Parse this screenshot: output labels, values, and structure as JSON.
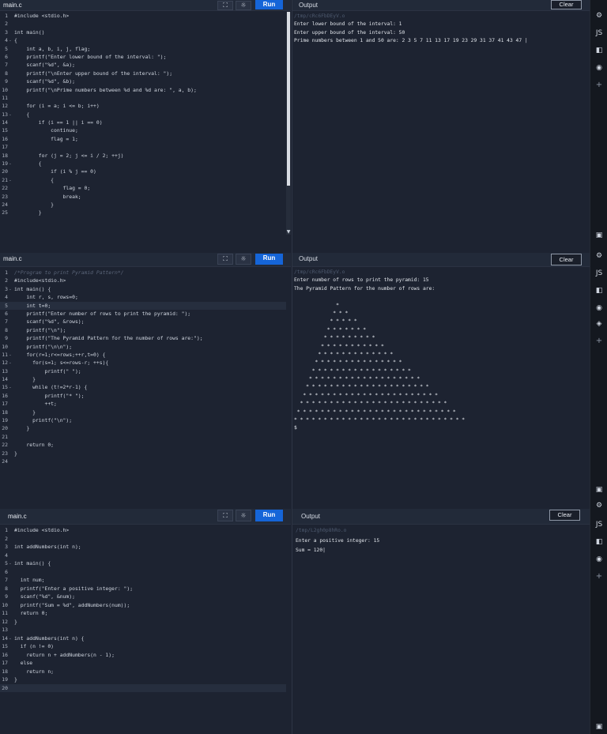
{
  "panels": [
    {
      "file": "main.c",
      "run_label": "Run",
      "output_title": "Output",
      "clear_label": "Clear",
      "code": [
        {
          "n": "1",
          "f": "",
          "t": "#include <stdio.h>"
        },
        {
          "n": "2",
          "f": "",
          "t": ""
        },
        {
          "n": "3",
          "f": "",
          "t": "int main()"
        },
        {
          "n": "4",
          "f": "-",
          "t": "{"
        },
        {
          "n": "5",
          "f": "",
          "t": "    int a, b, i, j, flag;"
        },
        {
          "n": "6",
          "f": "",
          "t": "    printf(\"Enter lower bound of the interval: \");"
        },
        {
          "n": "7",
          "f": "",
          "t": "    scanf(\"%d\", &a);"
        },
        {
          "n": "8",
          "f": "",
          "t": "    printf(\"\\nEnter upper bound of the interval: \");"
        },
        {
          "n": "9",
          "f": "",
          "t": "    scanf(\"%d\", &b);"
        },
        {
          "n": "10",
          "f": "",
          "t": "    printf(\"\\nPrime numbers between %d and %d are: \", a, b);"
        },
        {
          "n": "11",
          "f": "",
          "t": ""
        },
        {
          "n": "12",
          "f": "",
          "t": "    for (i = a; i <= b; i++)"
        },
        {
          "n": "13",
          "f": "-",
          "t": "    {"
        },
        {
          "n": "14",
          "f": "",
          "t": "        if (i == 1 || i == 0)"
        },
        {
          "n": "15",
          "f": "",
          "t": "            continue;"
        },
        {
          "n": "16",
          "f": "",
          "t": "            flag = 1;"
        },
        {
          "n": "17",
          "f": "",
          "t": ""
        },
        {
          "n": "18",
          "f": "",
          "t": "        for (j = 2; j <= i / 2; ++j)"
        },
        {
          "n": "19",
          "f": "-",
          "t": "        {"
        },
        {
          "n": "20",
          "f": "",
          "t": "            if (i % j == 0)"
        },
        {
          "n": "21",
          "f": "-",
          "t": "            {"
        },
        {
          "n": "22",
          "f": "",
          "t": "                flag = 0;"
        },
        {
          "n": "23",
          "f": "",
          "t": "                break;"
        },
        {
          "n": "24",
          "f": "",
          "t": "            }"
        },
        {
          "n": "25",
          "f": "",
          "t": "        }"
        }
      ],
      "output": [
        {
          "t": "/tmp/cRc6FbDEyV.o",
          "path": true
        },
        {
          "t": "Enter lower bound of the interval: 1"
        },
        {
          "t": "Enter upper bound of the interval: 50"
        },
        {
          "t": "Prime numbers between 1 and 50 are: 2 3 5 7 11 13 17 19 23 29 31 37 41 43 47 |"
        }
      ]
    },
    {
      "file": "main.c",
      "run_label": "Run",
      "output_title": "Output",
      "clear_label": "Clear",
      "code": [
        {
          "n": "1",
          "f": "",
          "t": "/*Program to print Pyramid Pattern*/",
          "cmt": true
        },
        {
          "n": "2",
          "f": "",
          "t": "#include<stdio.h>"
        },
        {
          "n": "3",
          "f": "-",
          "t": "int main() {"
        },
        {
          "n": "4",
          "f": "",
          "t": "    int r, s, rows=0;"
        },
        {
          "n": "5",
          "f": "",
          "t": "    int t=0;",
          "active": true
        },
        {
          "n": "6",
          "f": "",
          "t": "    printf(\"Enter number of rows to print the pyramid: \");"
        },
        {
          "n": "7",
          "f": "",
          "t": "    scanf(\"%d\", &rows);"
        },
        {
          "n": "8",
          "f": "",
          "t": "    printf(\"\\n\");"
        },
        {
          "n": "9",
          "f": "",
          "t": "    printf(\"The Pyramid Pattern for the number of rows are:\");"
        },
        {
          "n": "10",
          "f": "",
          "t": "    printf(\"\\n\\n\");"
        },
        {
          "n": "11",
          "f": "-",
          "t": "    for(r=1;r<=rows;++r,t=0) {"
        },
        {
          "n": "12",
          "f": "-",
          "t": "      for(s=1; s<=rows-r; ++s){"
        },
        {
          "n": "13",
          "f": "",
          "t": "          printf(\" \");"
        },
        {
          "n": "14",
          "f": "",
          "t": "      }"
        },
        {
          "n": "15",
          "f": "-",
          "t": "      while (t!=2*r-1) {"
        },
        {
          "n": "16",
          "f": "",
          "t": "          printf(\"* \");"
        },
        {
          "n": "17",
          "f": "",
          "t": "          ++t;"
        },
        {
          "n": "18",
          "f": "",
          "t": "      }"
        },
        {
          "n": "19",
          "f": "",
          "t": "      printf(\"\\n\");"
        },
        {
          "n": "20",
          "f": "",
          "t": "    }"
        },
        {
          "n": "21",
          "f": "",
          "t": ""
        },
        {
          "n": "22",
          "f": "",
          "t": "    return 0;"
        },
        {
          "n": "23",
          "f": "",
          "t": "}"
        },
        {
          "n": "24",
          "f": "",
          "t": ""
        }
      ],
      "output": [
        {
          "t": "/tmp/cRc6FbDEyV.o",
          "path": true
        },
        {
          "t": "Enter number of rows to print the pyramid: 15"
        },
        {
          "t": "The Pyramid Pattern for the number of rows are:"
        },
        {
          "t": ""
        },
        {
          "t": "              *"
        },
        {
          "t": "             * * *"
        },
        {
          "t": "            * * * * *"
        },
        {
          "t": "           * * * * * * *"
        },
        {
          "t": "          * * * * * * * * *"
        },
        {
          "t": "         * * * * * * * * * * *"
        },
        {
          "t": "        * * * * * * * * * * * * *"
        },
        {
          "t": "       * * * * * * * * * * * * * * *"
        },
        {
          "t": "      * * * * * * * * * * * * * * * * *"
        },
        {
          "t": "     * * * * * * * * * * * * * * * * * * *"
        },
        {
          "t": "    * * * * * * * * * * * * * * * * * * * * *"
        },
        {
          "t": "   * * * * * * * * * * * * * * * * * * * * * * *"
        },
        {
          "t": "  * * * * * * * * * * * * * * * * * * * * * * * * *"
        },
        {
          "t": " * * * * * * * * * * * * * * * * * * * * * * * * * * *"
        },
        {
          "t": "* * * * * * * * * * * * * * * * * * * * * * * * * * * * *"
        },
        {
          "t": "$"
        }
      ]
    },
    {
      "file": "main.c",
      "run_label": "Run",
      "output_title": "Output",
      "clear_label": "Clear",
      "code": [
        {
          "n": "1",
          "f": "",
          "t": "#include <stdio.h>"
        },
        {
          "n": "2",
          "f": "",
          "t": ""
        },
        {
          "n": "3",
          "f": "",
          "t": "int addNumbers(int n);"
        },
        {
          "n": "4",
          "f": "",
          "t": ""
        },
        {
          "n": "5",
          "f": "-",
          "t": "int main() {"
        },
        {
          "n": "6",
          "f": "",
          "t": ""
        },
        {
          "n": "7",
          "f": "",
          "t": "  int num;"
        },
        {
          "n": "8",
          "f": "",
          "t": "  printf(\"Enter a positive integer: \");"
        },
        {
          "n": "9",
          "f": "",
          "t": "  scanf(\"%d\", &num);"
        },
        {
          "n": "10",
          "f": "",
          "t": "  printf(\"Sum = %d\", addNumbers(num));"
        },
        {
          "n": "11",
          "f": "",
          "t": "  return 0;"
        },
        {
          "n": "12",
          "f": "",
          "t": "}"
        },
        {
          "n": "13",
          "f": "",
          "t": ""
        },
        {
          "n": "14",
          "f": "-",
          "t": "int addNumbers(int n) {"
        },
        {
          "n": "15",
          "f": "",
          "t": "  if (n != 0)"
        },
        {
          "n": "16",
          "f": "",
          "t": "    return n + addNumbers(n - 1);"
        },
        {
          "n": "17",
          "f": "",
          "t": "  else"
        },
        {
          "n": "18",
          "f": "",
          "t": "    return n;"
        },
        {
          "n": "19",
          "f": "",
          "t": "}"
        },
        {
          "n": "20",
          "f": "",
          "t": "",
          "active": true
        }
      ],
      "output": [
        {
          "t": "/tmp/L2gh0p8hRo.o",
          "path": true
        },
        {
          "t": "Enter a positive integer: 15"
        },
        {
          "t": "Sum = 120|"
        }
      ]
    }
  ]
}
